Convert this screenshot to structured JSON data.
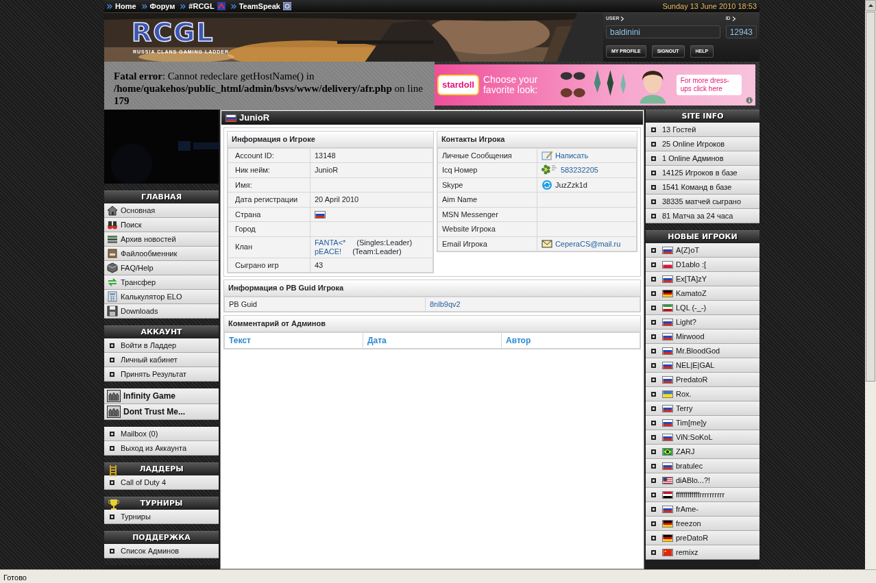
{
  "top_nav": {
    "links": [
      {
        "label": "Home"
      },
      {
        "label": "Форум"
      },
      {
        "label": "#RCGL",
        "kind": "irc"
      },
      {
        "label": "TeamSpeak",
        "kind": "teamspeak"
      }
    ],
    "date": "Sunday 13 June 2010 18:53"
  },
  "header": {
    "logo": "RCGL",
    "tagline": "RUSSIA CLANS GAMING LADDER",
    "user_label": "USER",
    "user_value": "baldinini",
    "id_label": "ID",
    "id_value": "12943",
    "buttons": [
      "MY PROFILE",
      "SIGNOUT",
      "HELP"
    ]
  },
  "error": "**Fatal error**: Cannot redeclare getHostName() in **/home/quakehos/public_html/admin/bsvs/www/delivery/afr.php** on line **179**",
  "ad": {
    "brand": "stardoll",
    "headline": "Choose your favorite look:",
    "cta": "For more dress-ups click here"
  },
  "left_menus": [
    {
      "title": "ГЛАВНАЯ",
      "items": [
        {
          "label": "Основная",
          "kind": "home"
        },
        {
          "label": "Поиск",
          "kind": "binoculars"
        },
        {
          "label": "Архив новостей",
          "kind": "news"
        },
        {
          "label": "Файлообменник",
          "kind": "files"
        },
        {
          "label": "FAQ/Help",
          "kind": "faq"
        },
        {
          "label": "Трансфер",
          "kind": "transfer"
        },
        {
          "label": "Калькулятор ELO",
          "kind": "calculator"
        },
        {
          "label": "Downloads",
          "kind": "downloads"
        }
      ]
    },
    {
      "title": "АККАУНТ",
      "items": [
        {
          "label": "Войти в Ладдер",
          "kind": "bullet"
        },
        {
          "label": "Личный кабинет",
          "kind": "bullet"
        },
        {
          "label": "Принять Результат",
          "kind": "bullet"
        }
      ]
    },
    {
      "items": [
        {
          "label": "Infinity Game",
          "kind": "clan"
        },
        {
          "label": "Dont Trust Me...",
          "kind": "clan"
        }
      ]
    },
    {
      "items": [
        {
          "label": "Mailbox (0)",
          "kind": "bullet"
        },
        {
          "label": "Выход из Аккаунта",
          "kind": "bullet"
        }
      ]
    },
    {
      "title": "ЛАДДЕРЫ",
      "kind": "ladder",
      "items": [
        {
          "label": "Call of Duty 4",
          "kind": "bullet"
        }
      ]
    },
    {
      "title": "ТУРНИРЫ",
      "kind": "trophy",
      "items": [
        {
          "label": "Турниры",
          "kind": "bullet"
        }
      ]
    },
    {
      "title": "ПОДДЕРЖКА",
      "items": [
        {
          "label": "Список Админов",
          "kind": "bullet"
        }
      ]
    }
  ],
  "player": {
    "name": "JunioR",
    "kind": "ru"
  },
  "info": {
    "title": "Информация о Игроке",
    "rows": [
      {
        "label": "Account ID:",
        "value": "13148"
      },
      {
        "label": "Ник нейм:",
        "value": "JunioR"
      },
      {
        "label": "Имя:"
      },
      {
        "label": "Дата регистрации",
        "value": "20 April 2010"
      },
      {
        "label": "Страна",
        "kind": "flag"
      },
      {
        "label": "Город"
      },
      {
        "label": "Клан",
        "clans": [
          {
            "name": "FANTA<*",
            "role": "(Singles:Leader)"
          },
          {
            "name": "pEACE!",
            "role": "(Team:Leader)"
          }
        ]
      },
      {
        "label": "Сыграно игр",
        "value": "43"
      }
    ]
  },
  "contacts": {
    "title": "Контакты Игрока",
    "rows": [
      {
        "label": "Личные Сообщения",
        "value": "Написать",
        "kind": "compose",
        "link": true
      },
      {
        "label": "Icq Номер",
        "value": "583232205",
        "kind": "icq",
        "link": true
      },
      {
        "label": "Skype",
        "value": "JuzZzk1d",
        "kind": "skype",
        "link": false
      },
      {
        "label": "Aim Name"
      },
      {
        "label": "MSN Messenger"
      },
      {
        "label": "Website Игрока"
      },
      {
        "label": "Email Игрока",
        "value": "CeperaCS@mail.ru",
        "kind": "mail",
        "link": true
      }
    ]
  },
  "pb": {
    "title": "Информация о PB Guid Игрока",
    "label": "PB Guid",
    "value": "8nlb9qv2"
  },
  "comments": {
    "title": "Комментарий от Админов",
    "columns": [
      "Текст",
      "Дата",
      "Автор"
    ]
  },
  "site_info": {
    "title": "SITE INFO",
    "items": [
      "13 Гостей",
      "25 Online Игроков",
      "1 Online Админов",
      "14125 Игроков в базе",
      "1541 Команд в базе",
      "38335 матчей сыграно",
      "81 Матча за 24 часа"
    ]
  },
  "new_players": {
    "title": "НОВЫЕ ИГРОКИ",
    "items": [
      {
        "name": "A{Z}oT",
        "kind": "ru"
      },
      {
        "name": "D1ablo :[",
        "kind": "pl"
      },
      {
        "name": "Ex[TA]zY",
        "kind": "ru"
      },
      {
        "name": "KamatoZ",
        "kind": "de"
      },
      {
        "name": "LQL (-_-)",
        "kind": "ir"
      },
      {
        "name": "Light?",
        "kind": "ru"
      },
      {
        "name": "Mirwood",
        "kind": "ru"
      },
      {
        "name": "Mr.BloodGod",
        "kind": "ru"
      },
      {
        "name": "NEL|E|GAL",
        "kind": "ru"
      },
      {
        "name": "PredatoR",
        "kind": "ru"
      },
      {
        "name": "Rox.",
        "kind": "ua"
      },
      {
        "name": "Terry",
        "kind": "ru"
      },
      {
        "name": "Tim[me]y",
        "kind": "ru"
      },
      {
        "name": "ViN:SoKoL",
        "kind": "ru"
      },
      {
        "name": "ZARJ",
        "kind": "br"
      },
      {
        "name": "bratulec",
        "kind": "ru"
      },
      {
        "name": "diABlo...?!",
        "kind": "us"
      },
      {
        "name": "ffffffffffffrrrrrrrrrr",
        "kind": "eg"
      },
      {
        "name": "frAme-",
        "kind": "ru"
      },
      {
        "name": "freezon",
        "kind": "de"
      },
      {
        "name": "preDatoR",
        "kind": "de"
      },
      {
        "name": "remixz",
        "kind": "cn"
      }
    ]
  },
  "status_bar": "Готово"
}
